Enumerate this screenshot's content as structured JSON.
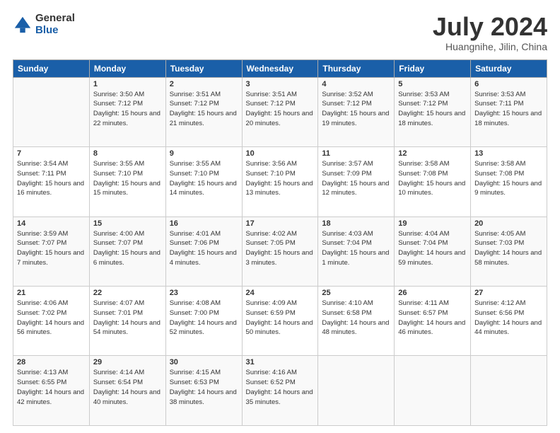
{
  "logo": {
    "general": "General",
    "blue": "Blue"
  },
  "title": {
    "month_year": "July 2024",
    "location": "Huangnihe, Jilin, China"
  },
  "weekdays": [
    "Sunday",
    "Monday",
    "Tuesday",
    "Wednesday",
    "Thursday",
    "Friday",
    "Saturday"
  ],
  "weeks": [
    [
      {
        "day": "",
        "sunrise": "",
        "sunset": "",
        "daylight": ""
      },
      {
        "day": "1",
        "sunrise": "Sunrise: 3:50 AM",
        "sunset": "Sunset: 7:12 PM",
        "daylight": "Daylight: 15 hours and 22 minutes."
      },
      {
        "day": "2",
        "sunrise": "Sunrise: 3:51 AM",
        "sunset": "Sunset: 7:12 PM",
        "daylight": "Daylight: 15 hours and 21 minutes."
      },
      {
        "day": "3",
        "sunrise": "Sunrise: 3:51 AM",
        "sunset": "Sunset: 7:12 PM",
        "daylight": "Daylight: 15 hours and 20 minutes."
      },
      {
        "day": "4",
        "sunrise": "Sunrise: 3:52 AM",
        "sunset": "Sunset: 7:12 PM",
        "daylight": "Daylight: 15 hours and 19 minutes."
      },
      {
        "day": "5",
        "sunrise": "Sunrise: 3:53 AM",
        "sunset": "Sunset: 7:12 PM",
        "daylight": "Daylight: 15 hours and 18 minutes."
      },
      {
        "day": "6",
        "sunrise": "Sunrise: 3:53 AM",
        "sunset": "Sunset: 7:11 PM",
        "daylight": "Daylight: 15 hours and 18 minutes."
      }
    ],
    [
      {
        "day": "7",
        "sunrise": "Sunrise: 3:54 AM",
        "sunset": "Sunset: 7:11 PM",
        "daylight": "Daylight: 15 hours and 16 minutes."
      },
      {
        "day": "8",
        "sunrise": "Sunrise: 3:55 AM",
        "sunset": "Sunset: 7:10 PM",
        "daylight": "Daylight: 15 hours and 15 minutes."
      },
      {
        "day": "9",
        "sunrise": "Sunrise: 3:55 AM",
        "sunset": "Sunset: 7:10 PM",
        "daylight": "Daylight: 15 hours and 14 minutes."
      },
      {
        "day": "10",
        "sunrise": "Sunrise: 3:56 AM",
        "sunset": "Sunset: 7:10 PM",
        "daylight": "Daylight: 15 hours and 13 minutes."
      },
      {
        "day": "11",
        "sunrise": "Sunrise: 3:57 AM",
        "sunset": "Sunset: 7:09 PM",
        "daylight": "Daylight: 15 hours and 12 minutes."
      },
      {
        "day": "12",
        "sunrise": "Sunrise: 3:58 AM",
        "sunset": "Sunset: 7:08 PM",
        "daylight": "Daylight: 15 hours and 10 minutes."
      },
      {
        "day": "13",
        "sunrise": "Sunrise: 3:58 AM",
        "sunset": "Sunset: 7:08 PM",
        "daylight": "Daylight: 15 hours and 9 minutes."
      }
    ],
    [
      {
        "day": "14",
        "sunrise": "Sunrise: 3:59 AM",
        "sunset": "Sunset: 7:07 PM",
        "daylight": "Daylight: 15 hours and 7 minutes."
      },
      {
        "day": "15",
        "sunrise": "Sunrise: 4:00 AM",
        "sunset": "Sunset: 7:07 PM",
        "daylight": "Daylight: 15 hours and 6 minutes."
      },
      {
        "day": "16",
        "sunrise": "Sunrise: 4:01 AM",
        "sunset": "Sunset: 7:06 PM",
        "daylight": "Daylight: 15 hours and 4 minutes."
      },
      {
        "day": "17",
        "sunrise": "Sunrise: 4:02 AM",
        "sunset": "Sunset: 7:05 PM",
        "daylight": "Daylight: 15 hours and 3 minutes."
      },
      {
        "day": "18",
        "sunrise": "Sunrise: 4:03 AM",
        "sunset": "Sunset: 7:04 PM",
        "daylight": "Daylight: 15 hours and 1 minute."
      },
      {
        "day": "19",
        "sunrise": "Sunrise: 4:04 AM",
        "sunset": "Sunset: 7:04 PM",
        "daylight": "Daylight: 14 hours and 59 minutes."
      },
      {
        "day": "20",
        "sunrise": "Sunrise: 4:05 AM",
        "sunset": "Sunset: 7:03 PM",
        "daylight": "Daylight: 14 hours and 58 minutes."
      }
    ],
    [
      {
        "day": "21",
        "sunrise": "Sunrise: 4:06 AM",
        "sunset": "Sunset: 7:02 PM",
        "daylight": "Daylight: 14 hours and 56 minutes."
      },
      {
        "day": "22",
        "sunrise": "Sunrise: 4:07 AM",
        "sunset": "Sunset: 7:01 PM",
        "daylight": "Daylight: 14 hours and 54 minutes."
      },
      {
        "day": "23",
        "sunrise": "Sunrise: 4:08 AM",
        "sunset": "Sunset: 7:00 PM",
        "daylight": "Daylight: 14 hours and 52 minutes."
      },
      {
        "day": "24",
        "sunrise": "Sunrise: 4:09 AM",
        "sunset": "Sunset: 6:59 PM",
        "daylight": "Daylight: 14 hours and 50 minutes."
      },
      {
        "day": "25",
        "sunrise": "Sunrise: 4:10 AM",
        "sunset": "Sunset: 6:58 PM",
        "daylight": "Daylight: 14 hours and 48 minutes."
      },
      {
        "day": "26",
        "sunrise": "Sunrise: 4:11 AM",
        "sunset": "Sunset: 6:57 PM",
        "daylight": "Daylight: 14 hours and 46 minutes."
      },
      {
        "day": "27",
        "sunrise": "Sunrise: 4:12 AM",
        "sunset": "Sunset: 6:56 PM",
        "daylight": "Daylight: 14 hours and 44 minutes."
      }
    ],
    [
      {
        "day": "28",
        "sunrise": "Sunrise: 4:13 AM",
        "sunset": "Sunset: 6:55 PM",
        "daylight": "Daylight: 14 hours and 42 minutes."
      },
      {
        "day": "29",
        "sunrise": "Sunrise: 4:14 AM",
        "sunset": "Sunset: 6:54 PM",
        "daylight": "Daylight: 14 hours and 40 minutes."
      },
      {
        "day": "30",
        "sunrise": "Sunrise: 4:15 AM",
        "sunset": "Sunset: 6:53 PM",
        "daylight": "Daylight: 14 hours and 38 minutes."
      },
      {
        "day": "31",
        "sunrise": "Sunrise: 4:16 AM",
        "sunset": "Sunset: 6:52 PM",
        "daylight": "Daylight: 14 hours and 35 minutes."
      },
      {
        "day": "",
        "sunrise": "",
        "sunset": "",
        "daylight": ""
      },
      {
        "day": "",
        "sunrise": "",
        "sunset": "",
        "daylight": ""
      },
      {
        "day": "",
        "sunrise": "",
        "sunset": "",
        "daylight": ""
      }
    ]
  ]
}
